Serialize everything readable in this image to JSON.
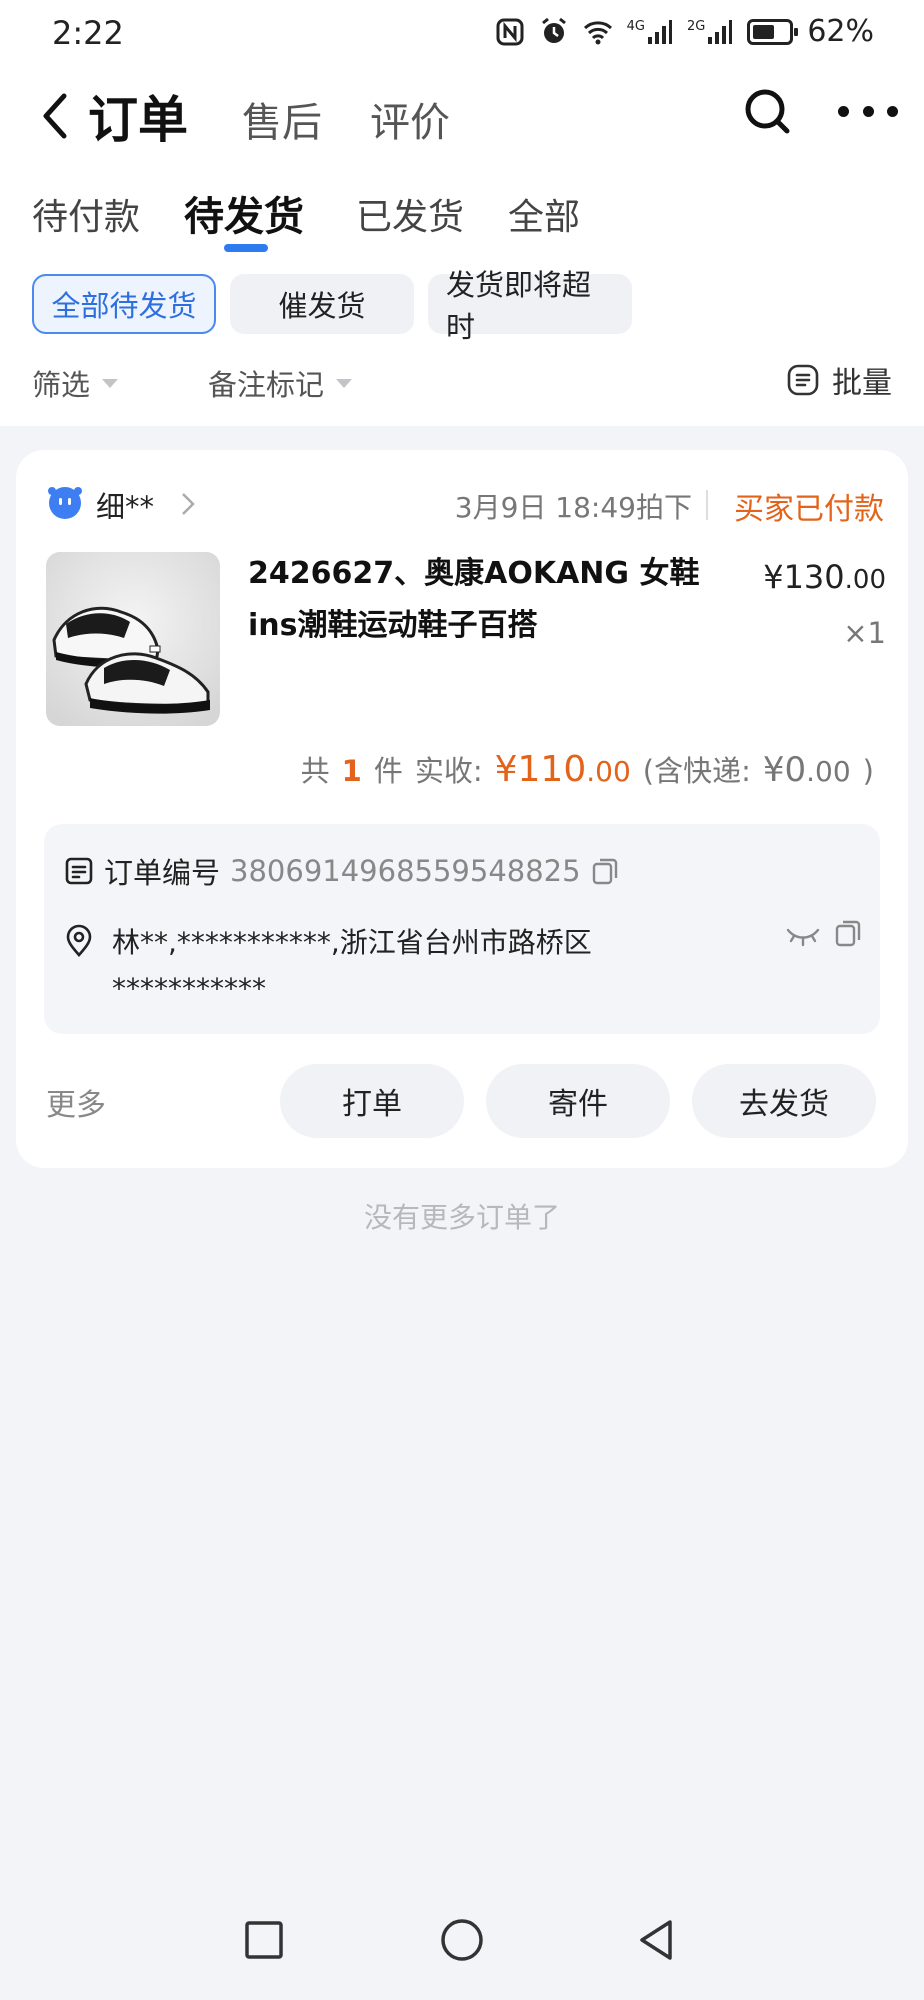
{
  "status_bar": {
    "time": "2:22",
    "network_4g": "4G",
    "network_2g": "2G",
    "battery": "62%",
    "battery_level": 0.62
  },
  "nav": {
    "title": "订单",
    "tabs": [
      "售后",
      "评价"
    ]
  },
  "sub_tabs": {
    "items": [
      "待付款",
      "待发货",
      "已发货",
      "全部"
    ],
    "active": "待发货"
  },
  "chips": [
    "全部待发货",
    "催发货",
    "发货即将超时"
  ],
  "filters": {
    "filter": "筛选",
    "remark": "备注标记",
    "batch": "批量"
  },
  "order": {
    "shop_name": "细**",
    "time": "3月9日 18:49拍下",
    "status": "买家已付款",
    "product_title": "2426627、奥康AOKANG 女鞋ins潮鞋运动鞋子百搭",
    "price_main": "¥130",
    "price_decimal": ".00",
    "quantity": "×1",
    "summary": {
      "prefix": "共",
      "count": "1",
      "unit": "件",
      "paid_label": "实收:",
      "paid_main": "¥110",
      "paid_decimal": ".00",
      "ship_open": "(含快递:",
      "ship_main": "¥0",
      "ship_decimal": ".00",
      "ship_close": ")"
    },
    "order_no_label": "订单编号",
    "order_no": "3806914968559548825",
    "address": "林**,***********,浙江省台州市路桥区***********",
    "more_label": "更多",
    "actions": [
      "打单",
      "寄件",
      "去发货"
    ]
  },
  "footer_text": "没有更多订单了",
  "colors": {
    "accent_blue": "#2e7bf0",
    "accent_orange": "#e4631b",
    "background": "#f3f4f8"
  }
}
